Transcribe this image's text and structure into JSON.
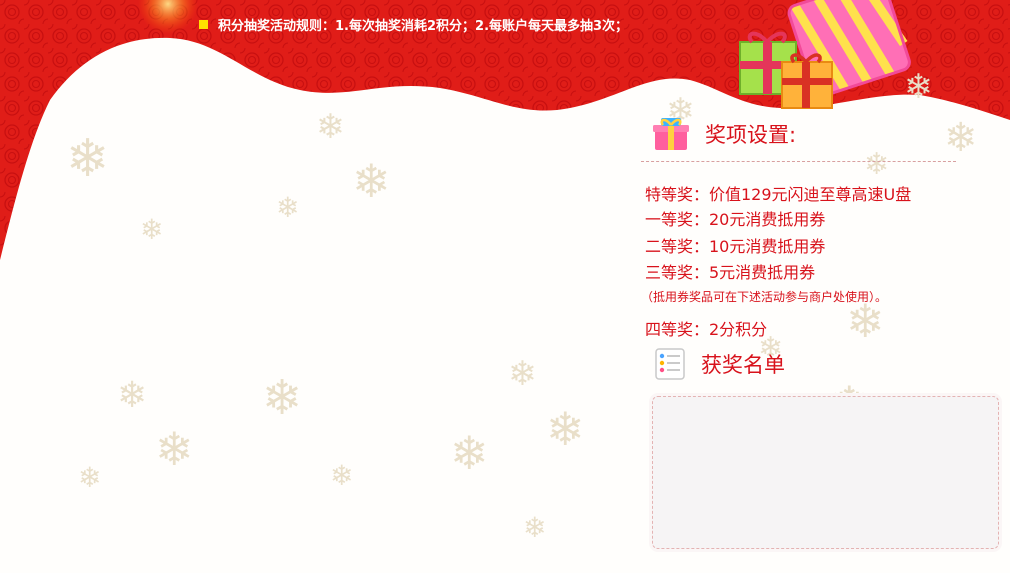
{
  "rules": {
    "text": "积分抽奖活动规则：1.每次抽奖消耗2积分；2.每账户每天最多抽3次；"
  },
  "prize_settings": {
    "title": "奖项设置:",
    "items": [
      {
        "label": "特等奖：价值129元闪迪至尊高速U盘"
      },
      {
        "label": "一等奖：20元消费抵用券"
      },
      {
        "label": "二等奖：10元消费抵用券"
      },
      {
        "label": "三等奖：5元消费抵用券"
      },
      {
        "label": "（抵用券奖品可在下述活动参与商户处使用）。"
      },
      {
        "label": "四等奖：2分积分"
      }
    ]
  },
  "winners": {
    "title": "获奖名单"
  },
  "colors": {
    "brand_red": "#d8121b",
    "banner_red": "#e01d18",
    "bullet_yellow": "#ffe000"
  },
  "icons": {
    "snowflake": "snowflake-icon",
    "gift": "gift-icon",
    "list": "list-icon"
  }
}
